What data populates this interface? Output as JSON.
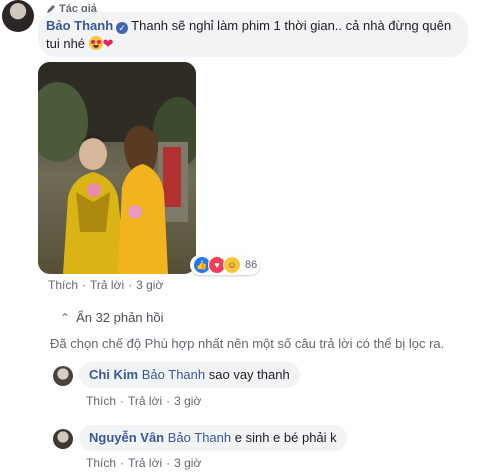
{
  "main_comment": {
    "author_badge": "Tác giả",
    "author_name": "Bảo Thanh",
    "text": "Thanh sẽ nghỉ làm phim 1 thời gian.. cả nhà đừng quên tui nhé",
    "reaction_count": "86",
    "actions": {
      "like": "Thích",
      "reply": "Trả lời",
      "time": "3 giờ"
    }
  },
  "replies_toggle": "Ẩn 32 phản hồi",
  "filter_note": "Đã chọn chế độ Phù hợp nhất nên một số câu trả lời có thể bị lọc ra.",
  "replies": [
    {
      "author": "Chi Kim",
      "mention": "Bảo Thanh",
      "text": "sao vay thanh",
      "actions": {
        "like": "Thích",
        "reply": "Trả lời",
        "time": "3 giờ"
      }
    },
    {
      "author": "Nguyễn Vân",
      "mention": "Bảo Thanh",
      "text": "e sinh e bé phải k",
      "actions": {
        "like": "Thích",
        "reply": "Trả lời",
        "time": "3 giờ"
      }
    }
  ],
  "colors": {
    "link": "#385898",
    "bubble": "#f2f3f5",
    "muted": "#606770",
    "like": "#2078f4",
    "love": "#f33e58"
  }
}
